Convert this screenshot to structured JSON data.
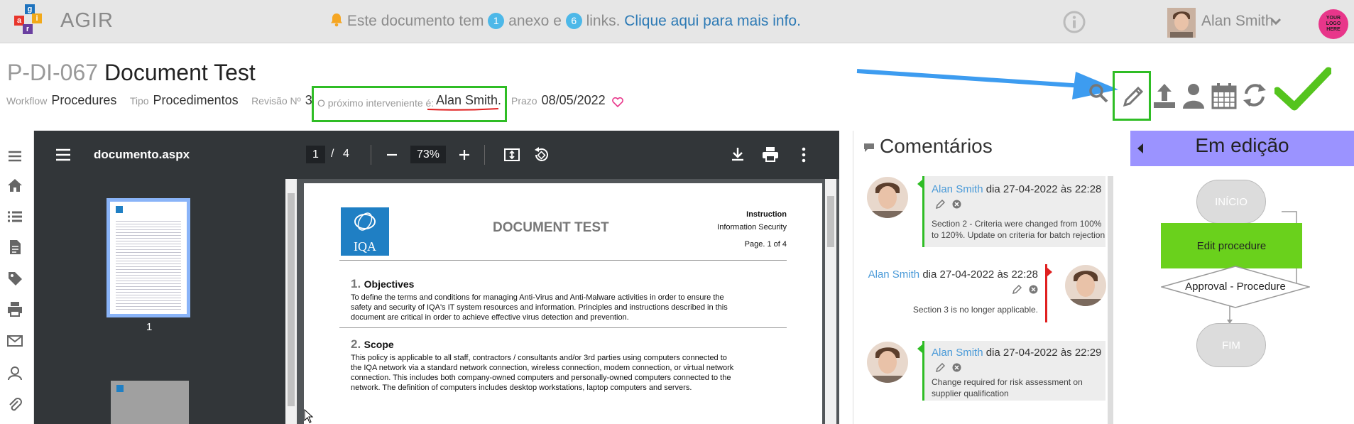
{
  "app": {
    "name": "AGIR",
    "logo_letters": [
      "a",
      "g",
      "i",
      "r"
    ]
  },
  "notice": {
    "pre": "Este documento tem",
    "attachments": "1",
    "mid1": "anexo e",
    "links": "6",
    "mid2": "links.",
    "link_text": "Clique aqui para mais info."
  },
  "user": {
    "name": "Alan Smith"
  },
  "company_logo": {
    "lines": [
      "YOUR",
      "LOGO",
      "HERE"
    ]
  },
  "document": {
    "code": "P-DI-067",
    "title": "Document Test",
    "workflow_label": "Workflow",
    "workflow_value": "Procedures",
    "type_label": "Tipo",
    "type_value": "Procedimentos",
    "revision_label": "Revisão Nº",
    "revision_value": "3",
    "next_label": "O próximo interveniente é:",
    "next_value": "Alan Smith.",
    "deadline_label": "Prazo",
    "deadline_value": "08/05/2022"
  },
  "pdf": {
    "filename": "documento.aspx",
    "page_current": "1",
    "page_sep": "/",
    "page_total": "4",
    "zoom": "73%",
    "thumb_label": "1",
    "page": {
      "logo_text": "IQA",
      "heading": "DOCUMENT TEST",
      "right1": "Instruction",
      "right2": "Information Security",
      "right3": "Page. 1 of 4",
      "s1_num": "1.",
      "s1_title": "Objectives",
      "s1_lines": [
        "To define the terms and conditions for managing Anti-Virus and Anti-Malware activities in order to ensure the",
        "safety and security of IQA's IT system resources and information. Principles and instructions described in this",
        "document are critical in order to achieve effective virus detection and prevention."
      ],
      "s2_num": "2.",
      "s2_title": "Scope",
      "s2_lines": [
        "This policy is applicable to all staff, contractors / consultants and/or 3rd parties using computers connected to",
        "the IQA network via a standard network connection, wireless connection, modem connection, or virtual network",
        "connection. This includes both company-owned computers and personally-owned computers connected to the",
        "network. The definition of computers includes desktop workstations, laptop computers and servers."
      ]
    }
  },
  "comments": {
    "title": "Comentários",
    "items": [
      {
        "name": "Alan Smith",
        "day_label": "dia",
        "date": "27-04-2022",
        "at": "às",
        "time": "22:28",
        "text": [
          "Section 2 - Criteria were changed from 100%",
          "to 120%. Update on criteria for batch rejection"
        ]
      },
      {
        "name": "Alan Smith",
        "day_label": "dia",
        "date": "27-04-2022",
        "at": "às",
        "time": "22:28",
        "text": [
          "Section 3 is no longer applicable."
        ]
      },
      {
        "name": "Alan Smith",
        "day_label": "dia",
        "date": "27-04-2022",
        "at": "às",
        "time": "22:29",
        "text": [
          "Change required for risk assessment on",
          "supplier qualification"
        ]
      }
    ]
  },
  "flow": {
    "title": "Em edição",
    "nodes": [
      "INÍCIO",
      "Edit procedure",
      "Approval - Procedure",
      "FIM"
    ]
  },
  "colors": {
    "accent_green": "#2fbd25",
    "flow_active": "#6ad11c",
    "arrow_blue": "#3d9cf0",
    "flow_header": "#9b93ff"
  }
}
